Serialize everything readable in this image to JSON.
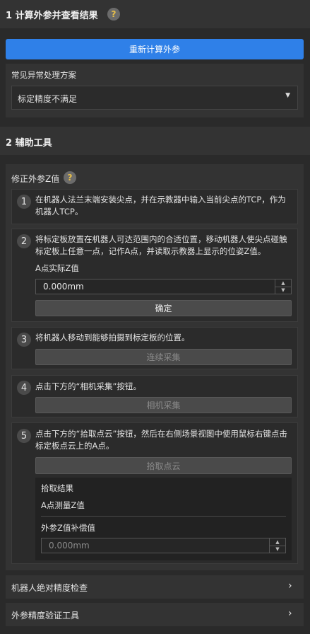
{
  "section1": {
    "title": "1 计算外参并查看结果",
    "help": "?",
    "recalc_button": "重新计算外参",
    "faq_label": "常见异常处理方案",
    "faq_selected": "标定精度不满足"
  },
  "section2": {
    "title": "2 辅助工具",
    "correction": {
      "title": "修正外参Z值",
      "help": "?",
      "steps": [
        {
          "num": "1",
          "text": "在机器人法兰末端安装尖点，并在示教器中输入当前尖点的TCP，作为机器人TCP。"
        },
        {
          "num": "2",
          "text": "将标定板放置在机器人可达范围内的合适位置，移动机器人使尖点碰触标定板上任意一点，记作A点，并读取示教器上显示的位姿Z值。",
          "field_label": "A点实际Z值",
          "field_value": "0.000mm",
          "button": "确定"
        },
        {
          "num": "3",
          "text": "将机器人移动到能够拍摄到标定板的位置。",
          "button": "连续采集"
        },
        {
          "num": "4",
          "text": "点击下方的“相机采集”按钮。",
          "button": "相机采集"
        },
        {
          "num": "5",
          "text": "点击下方的“拾取点云”按钮，然后在右侧场景视图中使用鼠标右键点击标定板点云上的A点。",
          "button": "拾取点云",
          "result_title": "拾取结果",
          "measured_label": "A点测量Z值",
          "comp_label": "外参Z值补偿值",
          "comp_value": "0.000mm"
        }
      ]
    },
    "collapsed": [
      {
        "label": "机器人绝对精度检查"
      },
      {
        "label": "外参精度验证工具"
      }
    ]
  }
}
